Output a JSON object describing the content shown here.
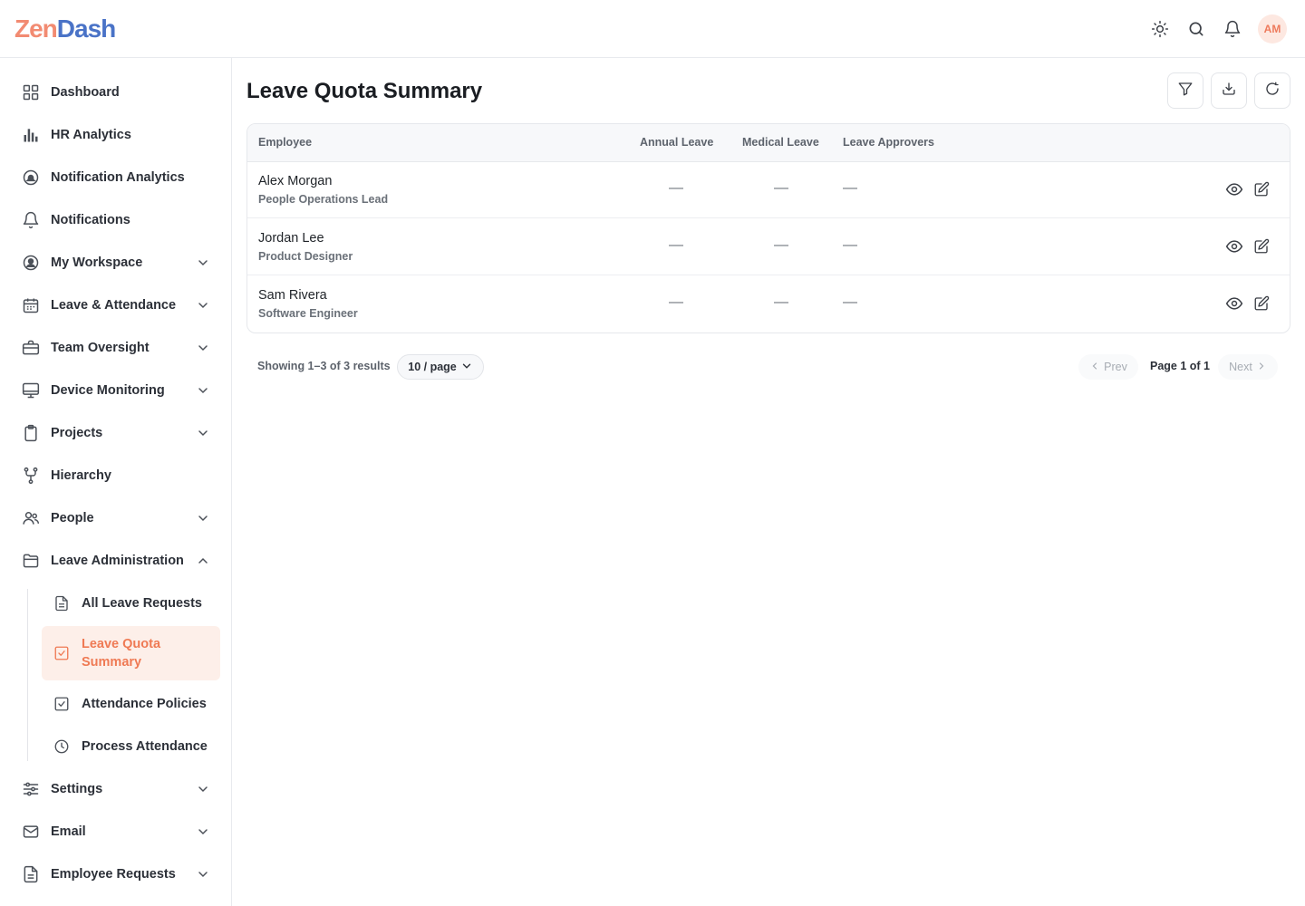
{
  "app": {
    "logo_part1": "Zen",
    "logo_part2": "Dash"
  },
  "header": {
    "icons": [
      "sun-icon",
      "search-icon",
      "bell-icon"
    ],
    "avatar_initials": "AM"
  },
  "sidebar": {
    "items": [
      {
        "label": "Dashboard",
        "icon": "grid-icon"
      },
      {
        "label": "HR Analytics",
        "icon": "bar-chart-icon"
      },
      {
        "label": "Notification Analytics",
        "icon": "notification-circle-icon"
      },
      {
        "label": "Notifications",
        "icon": "bell-icon"
      },
      {
        "label": "My Workspace",
        "icon": "user-circle-icon",
        "expandable": true
      },
      {
        "label": "Leave & Attendance",
        "icon": "calendar-icon",
        "expandable": true
      },
      {
        "label": "Team Oversight",
        "icon": "briefcase-icon",
        "expandable": true
      },
      {
        "label": "Device Monitoring",
        "icon": "monitor-icon",
        "expandable": true
      },
      {
        "label": "Projects",
        "icon": "clipboard-icon",
        "expandable": true
      },
      {
        "label": "Hierarchy",
        "icon": "hierarchy-icon"
      },
      {
        "label": "People",
        "icon": "people-icon",
        "expandable": true
      },
      {
        "label": "Leave Administration",
        "icon": "folder-icon",
        "expandable": true,
        "expanded": true
      },
      {
        "label": "Settings",
        "icon": "sliders-icon",
        "expandable": true
      },
      {
        "label": "Email",
        "icon": "mail-icon",
        "expandable": true
      },
      {
        "label": "Employee Requests",
        "icon": "document-icon",
        "expandable": true
      }
    ],
    "subitems": [
      {
        "label": "All Leave Requests",
        "icon": "document-icon"
      },
      {
        "label": "Leave Quota Summary",
        "icon": "check-square-icon",
        "active": true
      },
      {
        "label": "Attendance Policies",
        "icon": "check-square-icon"
      },
      {
        "label": "Process Attendance",
        "icon": "clock-icon"
      }
    ]
  },
  "main": {
    "title": "Leave Quota Summary",
    "toolbar": [
      "filter-icon",
      "download-icon",
      "refresh-icon"
    ],
    "table": {
      "columns": [
        "Employee",
        "Annual Leave",
        "Medical Leave",
        "Leave Approvers"
      ],
      "rows": [
        {
          "name": "Alex Morgan",
          "role": "People Operations Lead",
          "annual": "—",
          "medical": "—",
          "approvers": "—"
        },
        {
          "name": "Jordan Lee",
          "role": "Product Designer",
          "annual": "—",
          "medical": "—",
          "approvers": "—"
        },
        {
          "name": "Sam Rivera",
          "role": "Software Engineer",
          "annual": "—",
          "medical": "—",
          "approvers": "—"
        }
      ]
    },
    "pagination": {
      "info": "Showing 1–3 of 3 results",
      "page_size": "10 / page",
      "prev": "Prev",
      "page_indicator": "Page 1 of 1",
      "next": "Next"
    }
  },
  "colors": {
    "accent": "#ef7a54",
    "active_bg": "#fdefe9",
    "logo_blue": "#4a73c7",
    "logo_coral": "#f28b72"
  }
}
